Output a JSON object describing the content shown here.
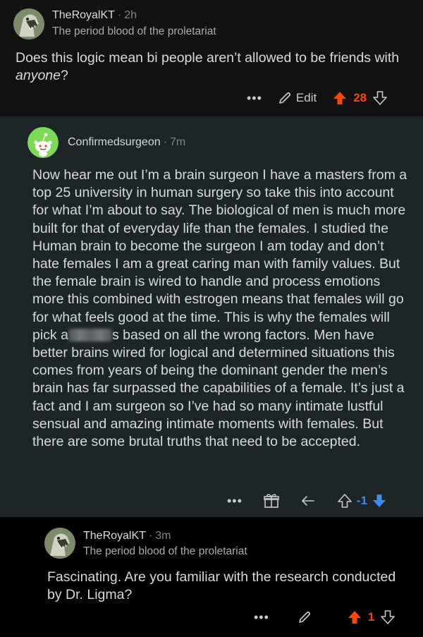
{
  "comments": [
    {
      "username": "TheRoyalKT",
      "time": "2h",
      "flair": "The period blood of the proletariat",
      "body_prefix": "Does this logic mean bi people aren’t allowed to be friends with ",
      "body_emph": "anyone",
      "body_suffix": "?",
      "edit_label": "Edit",
      "score": "28"
    },
    {
      "username": "Confirmedsurgeon",
      "time": "7m",
      "body_part1": "Now hear me out I’m a brain surgeon I have a masters from a top 25 university in human surgery so take this into account for what I’m about to say. The biological of men is much more built for that of everyday life than the females. I studied the Human brain to become the surgeon I am today and don’t hate females I am a great caring man with family values. But the female brain is wired to handle and process emotions more this combined with estrogen means that females will go for what feels good at the time. This is why the females will pick a",
      "body_part2": "s based on all the wrong factors. Men have better brains wired for logical and determined situations this comes from years of being the dominant gender the men’s brain has far surpassed the capabilities of a female. It’s just a fact and I am surgeon so I’ve had so many intimate lustful sensual and amazing intimate moments with females. But there are some brutal truths that need to be accepted.",
      "score": "-1"
    },
    {
      "username": "TheRoyalKT",
      "time": "3m",
      "flair": "The period blood of the proletariat",
      "body": "Fascinating. Are you familiar with the research conducted by Dr. Ligma?",
      "score": "1"
    }
  ],
  "icons": {
    "more": "ellipsis-icon",
    "edit": "pencil-icon",
    "upvote": "upvote-arrow-icon",
    "downvote": "downvote-arrow-icon",
    "award": "award-box-icon",
    "reply": "reply-arrow-icon"
  },
  "colors": {
    "upvote": "#ff4500",
    "downvote": "#3c8cf0",
    "text": "#d7dadc",
    "muted": "#818384"
  }
}
